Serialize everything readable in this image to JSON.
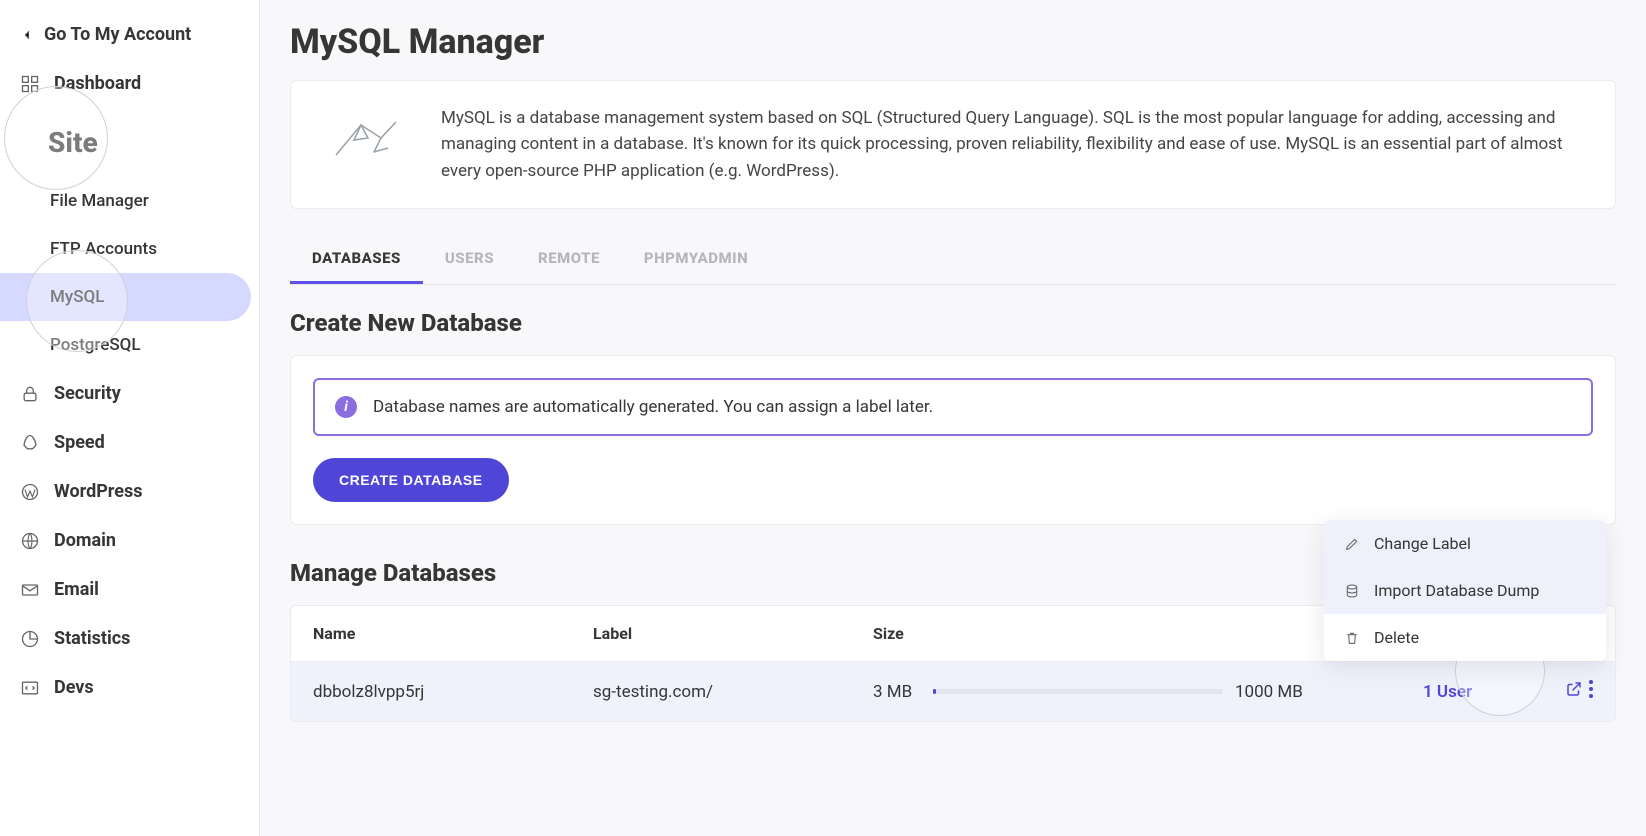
{
  "back_link": "Go To My Account",
  "sidebar": {
    "dashboard": "Dashboard",
    "site": "Site",
    "sub": {
      "file_manager": "File Manager",
      "ftp": "FTP Accounts",
      "mysql": "MySQL",
      "postgres": "PostgreSQL"
    },
    "security": "Security",
    "speed": "Speed",
    "wordpress": "WordPress",
    "domain": "Domain",
    "email": "Email",
    "statistics": "Statistics",
    "devs": "Devs"
  },
  "page_title": "MySQL Manager",
  "intro_text": "MySQL is a database management system based on SQL (Structured Query Language). SQL is the most popular language for adding, accessing and managing content in a database. It's known for its quick processing, proven reliability, flexibility and ease of use. MySQL is an essential part of almost every open-source PHP application (e.g. WordPress).",
  "tabs": {
    "databases": "DATABASES",
    "users": "USERS",
    "remote": "REMOTE",
    "phpmyadmin": "PHPMYADMIN"
  },
  "create": {
    "heading": "Create New Database",
    "info": "Database names are automatically generated. You can assign a label later.",
    "button": "CREATE DATABASE"
  },
  "manage": {
    "heading": "Manage Databases",
    "columns": {
      "name": "Name",
      "label": "Label",
      "size": "Size"
    },
    "rows": [
      {
        "name": "dbbolz8lvpp5rj",
        "label": "sg-testing.com/",
        "size": "3 MB",
        "max": "1000 MB",
        "users": "1 User"
      }
    ]
  },
  "dropdown": {
    "change_label": "Change Label",
    "import_dump": "Import Database Dump",
    "delete": "Delete"
  }
}
